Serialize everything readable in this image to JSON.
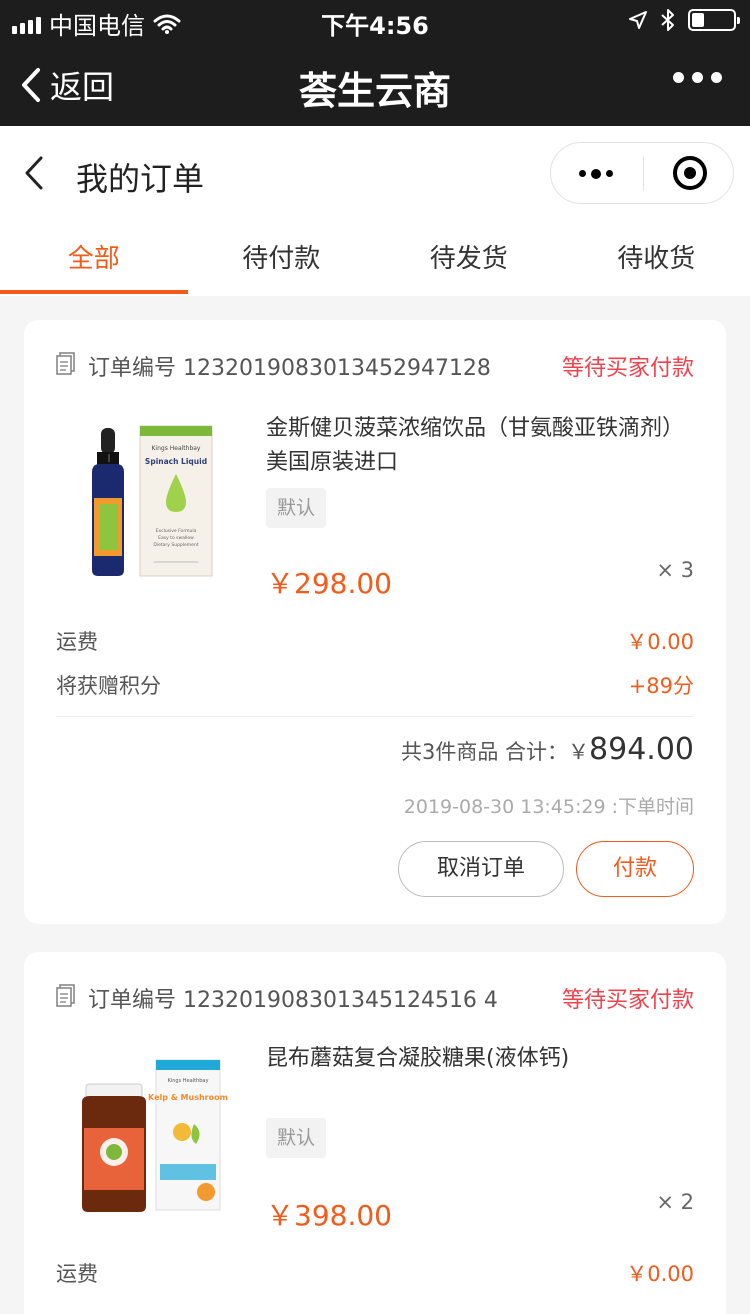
{
  "status_bar": {
    "carrier": "中国电信",
    "time": "下午4:56",
    "battery_level": 0.3
  },
  "nav": {
    "back_label": "返回",
    "title": "荟生云商"
  },
  "page": {
    "title": "我的订单"
  },
  "tabs": [
    {
      "label": "全部",
      "active": true
    },
    {
      "label": "待付款",
      "active": false
    },
    {
      "label": "待发货",
      "active": false
    },
    {
      "label": "待收货",
      "active": false
    }
  ],
  "orders": [
    {
      "number": "订单编号 1232019083013452947128",
      "status": "等待买家付款",
      "product_name": "金斯健贝菠菜浓缩饮品（甘氨酸亚铁滴剂）美国原装进口",
      "spec": "默认",
      "price": "￥298.00",
      "quantity": "× 3",
      "shipping_label": "运费",
      "shipping_value": "￥0.00",
      "points_label": "将获赠积分",
      "points_value": "+89分",
      "summary_text": "共3件商品 合计：￥",
      "total": "894.00",
      "time": "2019-08-30 13:45:29 :下单时间",
      "cancel_label": "取消订单",
      "pay_label": "付款",
      "box_text": "Spinach Liquid",
      "box_brand": "Kings Healthbay",
      "box_fine": [
        "Exclusive Formula",
        "Easy to swallow",
        "Dietary Supplement"
      ]
    },
    {
      "number": "订单编号 123201908301345124516 4",
      "status": "等待买家付款",
      "product_name": "昆布蘑菇复合凝胶糖果(液体钙)",
      "spec": "默认",
      "price": "￥398.00",
      "quantity": "× 2",
      "shipping_label": "运费",
      "shipping_value": "￥0.00",
      "box_text": "Kelp & Mushroom",
      "box_brand": "Kings Healthbay"
    }
  ],
  "colors": {
    "accent": "#f45a1a",
    "status_red": "#f2414b",
    "bar_bg": "#1d1d1d"
  }
}
